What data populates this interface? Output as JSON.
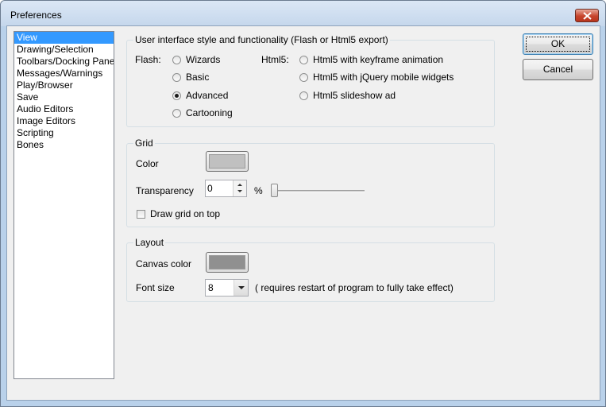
{
  "window": {
    "title": "Preferences"
  },
  "categories": [
    {
      "label": "View",
      "selected": true
    },
    {
      "label": "Drawing/Selection",
      "selected": false
    },
    {
      "label": "Toolbars/Docking Pane",
      "selected": false
    },
    {
      "label": "Messages/Warnings",
      "selected": false
    },
    {
      "label": "Play/Browser",
      "selected": false
    },
    {
      "label": "Save",
      "selected": false
    },
    {
      "label": "Audio Editors",
      "selected": false
    },
    {
      "label": "Image Editors",
      "selected": false
    },
    {
      "label": "Scripting",
      "selected": false
    },
    {
      "label": "Bones",
      "selected": false
    }
  ],
  "ui_style": {
    "group_label": "User interface style and functionality (Flash or Html5 export)",
    "flash_label": "Flash:",
    "flash_options": [
      "Wizards",
      "Basic",
      "Advanced",
      "Cartooning"
    ],
    "flash_selected": "Advanced",
    "html5_label": "Html5:",
    "html5_options": [
      "Html5 with keyframe animation",
      "Html5 with jQuery mobile widgets",
      "Html5 slideshow ad"
    ]
  },
  "grid": {
    "group_label": "Grid",
    "color_label": "Color",
    "color": "#c0c0c0",
    "transparency_label": "Transparency",
    "transparency_value": "0",
    "percent_label": "%",
    "transparency_slider": 0,
    "draw_on_top_label": "Draw grid on top",
    "draw_on_top_checked": false
  },
  "layout": {
    "group_label": "Layout",
    "canvas_color_label": "Canvas color",
    "canvas_color": "#909090",
    "font_size_label": "Font size",
    "font_size_value": "8",
    "restart_note": "( requires restart of program to fully take effect)"
  },
  "buttons": {
    "ok_label": "OK",
    "cancel_label": "Cancel"
  }
}
